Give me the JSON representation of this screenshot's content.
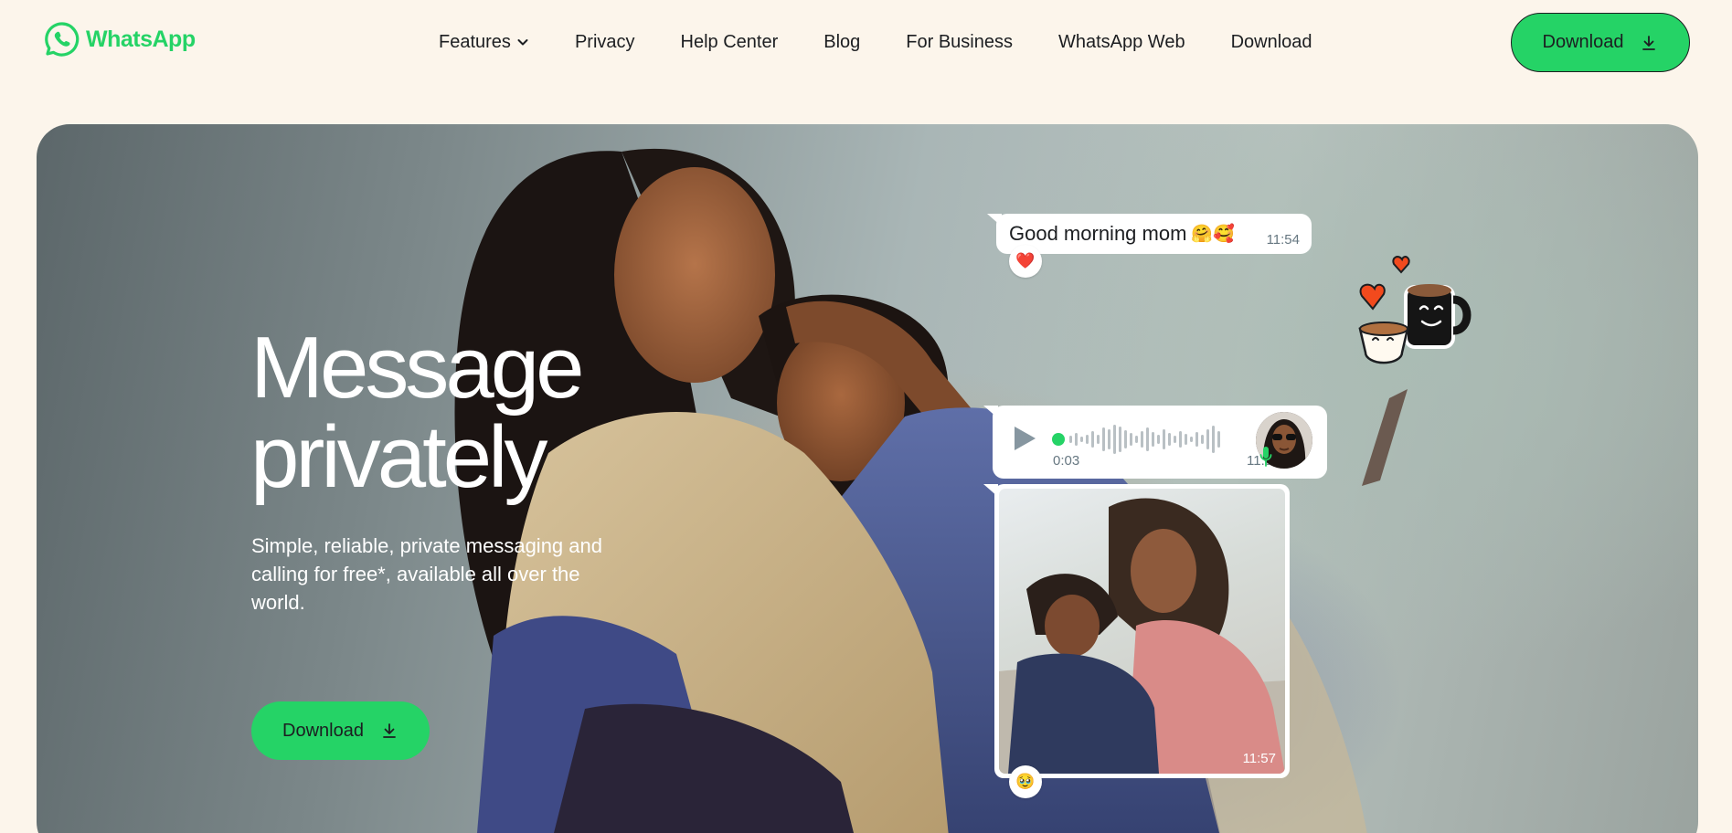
{
  "header": {
    "brand": "WhatsApp",
    "nav": [
      {
        "label": "Features",
        "has_dropdown": true
      },
      {
        "label": "Privacy"
      },
      {
        "label": "Help Center"
      },
      {
        "label": "Blog"
      },
      {
        "label": "For Business"
      },
      {
        "label": "WhatsApp Web"
      },
      {
        "label": "Download"
      }
    ],
    "download_label": "Download"
  },
  "hero": {
    "headline_line1": "Message",
    "headline_line2": "privately",
    "subline": "Simple, reliable, private messaging and calling for free*, available all over the world.",
    "download_label": "Download"
  },
  "chat": {
    "text_message": "Good morning mom",
    "text_message_emoji": "🤗🥰",
    "text_time": "11:54",
    "text_reaction": "❤️",
    "voice_duration": "0:03",
    "voice_time": "11:57",
    "photo_time": "11:57",
    "photo_reaction": "🥹"
  },
  "colors": {
    "brand_green": "#25d366",
    "page_bg": "#fcf5eb",
    "text_dark": "#1c1e21",
    "meta_grey": "#667781"
  },
  "icons": [
    "whatsapp-logo-icon",
    "chevron-down-icon",
    "download-icon",
    "play-icon",
    "waveform-icon",
    "microphone-icon",
    "coffee-sticker-icon"
  ]
}
